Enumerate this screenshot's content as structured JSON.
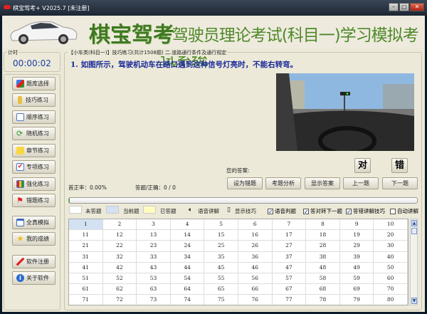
{
  "window": {
    "title": "棋宝驾考+ V2025.7 [未注册]",
    "controls": [
      "–",
      "□",
      "✕"
    ]
  },
  "header": {
    "brand": "棋宝驾考",
    "subtitle": "– 驾驶员理论考试(科目一)学习模拟考试系统"
  },
  "timer": {
    "label": "计时",
    "value": "00:00:02"
  },
  "sidebar": {
    "items": [
      {
        "label": "题库选择",
        "icon": "cubes-icon"
      },
      {
        "label": "技巧练习",
        "icon": "key-icon"
      },
      {
        "label": "顺序练习",
        "icon": "edit-icon"
      },
      {
        "label": "随机练习",
        "icon": "refresh-icon"
      },
      {
        "label": "章节练习",
        "icon": "note-icon"
      },
      {
        "label": "专项练习",
        "icon": "check-icon"
      },
      {
        "label": "强化练习",
        "icon": "chart-icon"
      },
      {
        "label": "错题练习",
        "icon": "flag-icon"
      },
      {
        "label": "全真模拟",
        "icon": "window-icon"
      },
      {
        "label": "我的成绩",
        "icon": "star-icon"
      },
      {
        "label": "软件注册",
        "icon": "screwdriver-icon"
      },
      {
        "label": "关于软件",
        "icon": "info-icon"
      }
    ]
  },
  "main": {
    "group_label": "【小车类(科目一)】技巧练习(共计1508题) 二.道路通行条件及通行规定",
    "question": "1. 如图所示，驾驶机动车在路口遇到这种信号灯亮时，不能右转弯。",
    "answer_label": "您的答案:",
    "true_label": "对",
    "false_label": "错",
    "buttons": [
      "设为错题",
      "考题分析",
      "显示答案",
      "上一题",
      "下一题"
    ],
    "accuracy": "首正率：0.00%",
    "answered": "答题/正确：0 / 0",
    "progress": 0
  },
  "legend": {
    "unanswered": "未答题",
    "current": "当前题",
    "answered": "已答题",
    "voice": "语音讲解",
    "tips": "显示技巧"
  },
  "options": [
    {
      "label": "语音判题",
      "checked": true
    },
    {
      "label": "答对转下一题",
      "checked": true
    },
    {
      "label": "答错讲解技巧",
      "checked": true
    },
    {
      "label": "自动讲解",
      "checked": false
    }
  ],
  "colors": {
    "current": "#d3e1f3",
    "answered": "#fffcc0",
    "brand": "#3f7a22"
  },
  "grid": {
    "current": 1,
    "first": 1,
    "last": 80
  }
}
